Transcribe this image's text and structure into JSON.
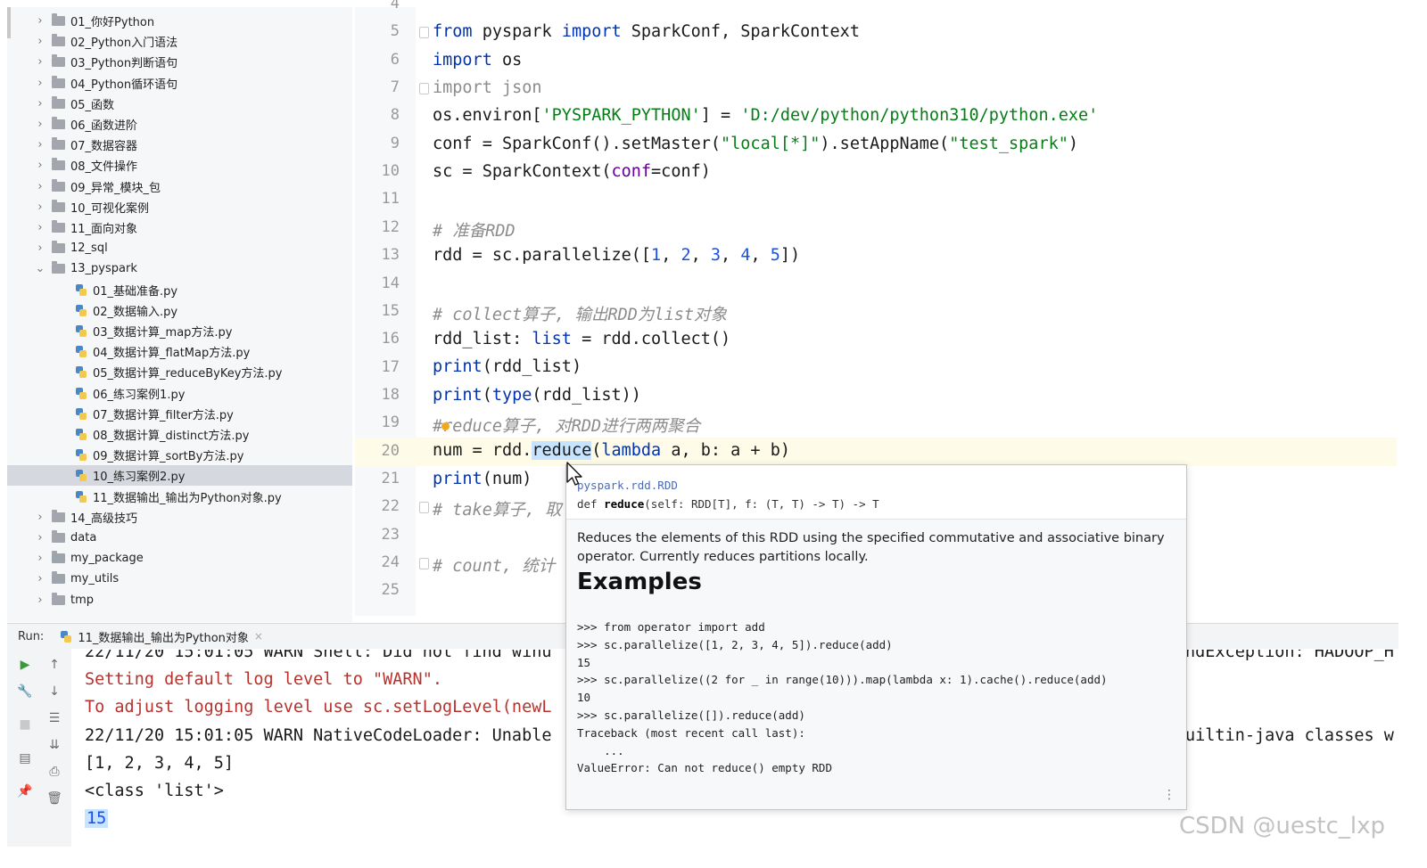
{
  "project_tree": {
    "items": [
      {
        "label": "01_你好Python",
        "kind": "folder",
        "chev": "›"
      },
      {
        "label": "02_Python入门语法",
        "kind": "folder",
        "chev": "›"
      },
      {
        "label": "03_Python判断语句",
        "kind": "folder",
        "chev": "›"
      },
      {
        "label": "04_Python循环语句",
        "kind": "folder",
        "chev": "›"
      },
      {
        "label": "05_函数",
        "kind": "folder",
        "chev": "›"
      },
      {
        "label": "06_函数进阶",
        "kind": "folder",
        "chev": "›"
      },
      {
        "label": "07_数据容器",
        "kind": "folder",
        "chev": "›"
      },
      {
        "label": "08_文件操作",
        "kind": "folder",
        "chev": "›"
      },
      {
        "label": "09_异常_模块_包",
        "kind": "folder",
        "chev": "›"
      },
      {
        "label": "10_可视化案例",
        "kind": "folder",
        "chev": "›"
      },
      {
        "label": "11_面向对象",
        "kind": "folder",
        "chev": "›"
      },
      {
        "label": "12_sql",
        "kind": "folder",
        "chev": "›"
      },
      {
        "label": "13_pyspark",
        "kind": "folder",
        "chev": "⌄"
      },
      {
        "label": "01_基础准备.py",
        "kind": "file"
      },
      {
        "label": "02_数据输入.py",
        "kind": "file"
      },
      {
        "label": "03_数据计算_map方法.py",
        "kind": "file"
      },
      {
        "label": "04_数据计算_flatMap方法.py",
        "kind": "file"
      },
      {
        "label": "05_数据计算_reduceByKey方法.py",
        "kind": "file"
      },
      {
        "label": "06_练习案例1.py",
        "kind": "file"
      },
      {
        "label": "07_数据计算_filter方法.py",
        "kind": "file"
      },
      {
        "label": "08_数据计算_distinct方法.py",
        "kind": "file"
      },
      {
        "label": "09_数据计算_sortBy方法.py",
        "kind": "file"
      },
      {
        "label": "10_练习案例2.py",
        "kind": "file",
        "selected": true
      },
      {
        "label": "11_数据输出_输出为Python对象.py",
        "kind": "file"
      },
      {
        "label": "14_高级技巧",
        "kind": "folder",
        "chev": "›"
      },
      {
        "label": "data",
        "kind": "folder",
        "chev": "›"
      },
      {
        "label": "my_package",
        "kind": "pkg",
        "chev": "›"
      },
      {
        "label": "my_utils",
        "kind": "pkg",
        "chev": "›"
      },
      {
        "label": "tmp",
        "kind": "folder",
        "chev": "›"
      }
    ]
  },
  "editor": {
    "line_numbers": [
      "4",
      "5",
      "6",
      "7",
      "8",
      "9",
      "10",
      "11",
      "12",
      "13",
      "14",
      "15",
      "16",
      "17",
      "18",
      "19",
      "20",
      "21",
      "22",
      "23",
      "24",
      "25"
    ],
    "lines": {
      "l5": {
        "a": "from",
        "b": " pyspark ",
        "c": "import",
        "d": " SparkConf, SparkContext"
      },
      "l6": {
        "a": "import",
        "b": " os"
      },
      "l7": {
        "a": "import json"
      },
      "l8": {
        "a": "os.environ[",
        "b": "'PYSPARK_PYTHON'",
        "c": "] = ",
        "d": "'D:/dev/python/python310/python.exe'"
      },
      "l9": {
        "a": "conf = SparkConf().setMaster(",
        "b": "\"local[*]\"",
        "c": ").setAppName(",
        "d": "\"test_spark\"",
        "e": ")"
      },
      "l10": {
        "a": "sc = SparkContext(",
        "b": "conf",
        "c": "=conf)"
      },
      "l12": {
        "a": "# 准备RDD"
      },
      "l13": {
        "a": "rdd = sc.parallelize([",
        "n1": "1",
        "s1": ", ",
        "n2": "2",
        "s2": ", ",
        "n3": "3",
        "s3": ", ",
        "n4": "4",
        "s4": ", ",
        "n5": "5",
        "e": "])"
      },
      "l15": {
        "a": "# collect算子, 输出RDD为list对象"
      },
      "l16": {
        "a": "rdd_list: ",
        "b": "list",
        "c": " = rdd.collect()"
      },
      "l17": {
        "a": "print",
        "b": "(rdd_list)"
      },
      "l18": {
        "a": "print",
        "b": "(",
        "c": "type",
        "d": "(rdd_list))"
      },
      "l19": {
        "a": "#",
        "b": "reduce算子, 对RDD进行两两聚合"
      },
      "l20": {
        "a": "num = rdd.",
        "b": "reduce",
        "c": "(",
        "d": "lambda",
        "e": " a, b: a + b)"
      },
      "l21": {
        "a": "print",
        "b": "(num)"
      },
      "l22": {
        "a": "# take算子, 取"
      },
      "l24": {
        "a": "# count, 统计"
      }
    }
  },
  "run_panel": {
    "label": "Run:",
    "tab_label": "11_数据输出_输出为Python对象",
    "tab_close": "×",
    "console": {
      "line0_left": "22/11/20 15:01:05 WARN Shell: Did not find winu",
      "line0_right": "ndException: HADOOP_H",
      "line1": "Setting default log level to \"WARN\".",
      "line2": "To adjust logging level use sc.setLogLevel(newL",
      "line3_left": "22/11/20 15:01:05 WARN NativeCodeLoader: Unable",
      "line3_right": "uiltin-java classes w",
      "line4": "[1, 2, 3, 4, 5]",
      "line5": "<class 'list'>",
      "line6": "15"
    }
  },
  "doc_popup": {
    "module": "pyspark.rdd.RDD",
    "sig_def": "def ",
    "sig_name": "reduce",
    "sig_rest": "(self: RDD[T], f: (T, T) -> T) -> T",
    "description": "Reduces the elements of this RDD using the specified commutative and associative binary operator. Currently reduces partitions locally.",
    "examples_title": "Examples",
    "examples": [
      ">>> from operator import add",
      ">>> sc.parallelize([1, 2, 3, 4, 5]).reduce(add)",
      "15",
      ">>> sc.parallelize((2 for _ in range(10))).map(lambda x: 1).cache().reduce(add)",
      "10",
      ">>> sc.parallelize([]).reduce(add)",
      "Traceback (most recent call last):",
      "    ...",
      "ValueError: Can not reduce() empty RDD"
    ],
    "more": "⋮"
  },
  "watermark": "CSDN @uestc_lxp",
  "colors": {
    "keyword": "#0033b3",
    "string": "#067d17",
    "comment": "#8c8c8c",
    "number": "#1750eb",
    "error": "#b8322d"
  },
  "icons": [
    "folder-icon",
    "python-file-icon",
    "run-icon",
    "rerun-icon",
    "stop-icon",
    "wrench-icon",
    "scroll-up-icon",
    "scroll-down-icon",
    "soft-wrap-icon",
    "print-icon",
    "trash-icon",
    "pin-icon",
    "layout-icon"
  ]
}
